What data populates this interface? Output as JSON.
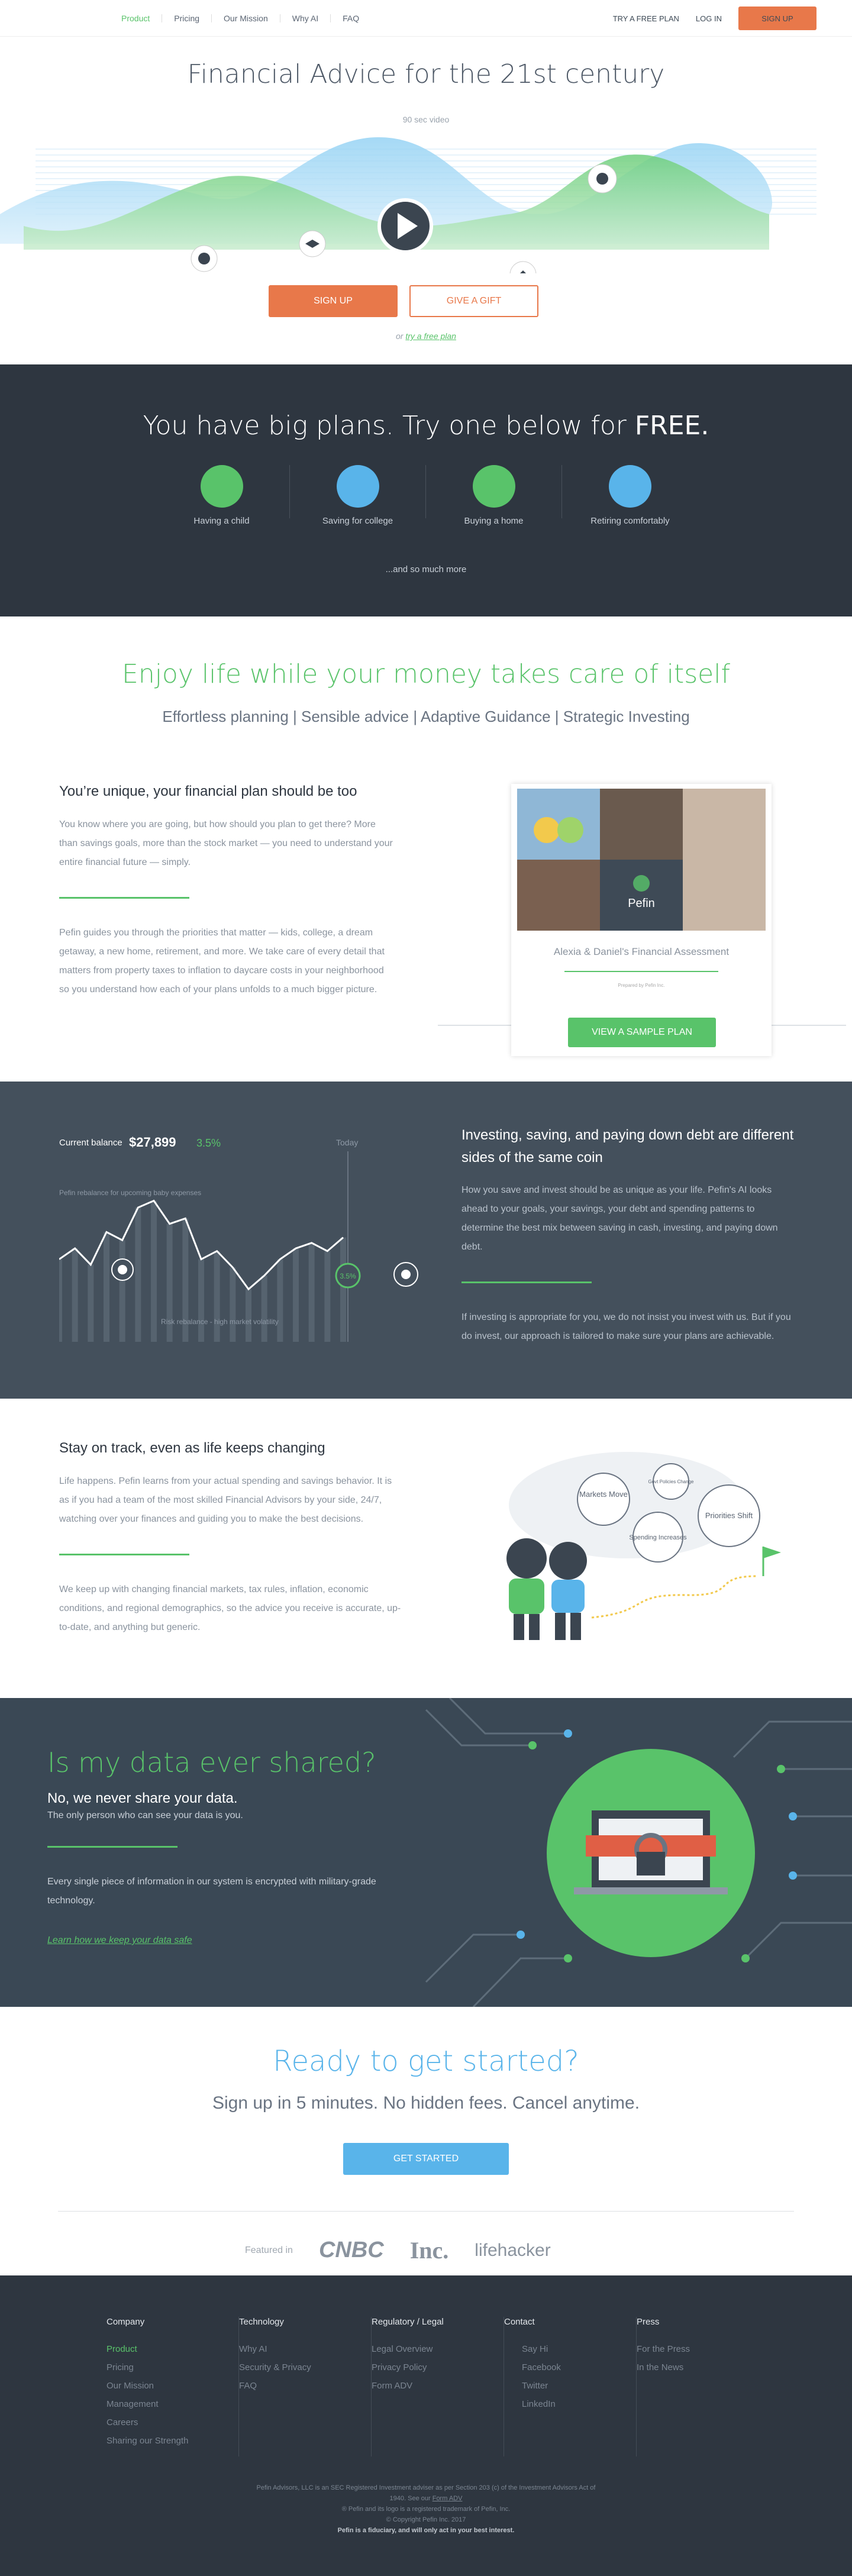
{
  "nav": {
    "links": [
      "Product",
      "Pricing",
      "Our Mission",
      "Why AI",
      "FAQ"
    ],
    "try_free": "TRY A FREE PLAN",
    "login": "LOG IN",
    "signup": "SIGN UP"
  },
  "hero": {
    "title": "Financial Advice for the 21st century",
    "video_label": "90 sec video",
    "signup": "SIGN UP",
    "gift": "GIVE A GIFT",
    "or": "or",
    "try_link": "try a free plan"
  },
  "plans": {
    "heading": "You have big plans. Try one below for",
    "heading_bold": "FREE.",
    "items": [
      {
        "label": "Having a child",
        "color": "#59c36a"
      },
      {
        "label": "Saving for college",
        "color": "#59b4ea"
      },
      {
        "label": "Buying a home",
        "color": "#59c36a"
      },
      {
        "label": "Retiring comfortably",
        "color": "#59b4ea"
      }
    ],
    "more": "...and so much more"
  },
  "enjoy": {
    "title": "Enjoy life while your money takes care of itself",
    "subtitle": "Effortless planning | Sensible advice | Adaptive Guidance | Strategic Investing",
    "heading": "You’re unique, your financial plan should be too",
    "p1": "You know where you are going, but how should you plan to get there? More than savings goals, more than the stock market — you need to understand your entire financial future — simply.",
    "p2": "Pefin guides you through the priorities that matter — kids, college, a dream getaway, a new home, retirement, and more. We take care of every detail that matters from property taxes to inflation to daycare costs in your neighborhood so you understand how each of your plans unfolds to a much bigger picture.",
    "card_brand": "Pefin",
    "card_name": "Alexia & Daniel's  Financial Assessment",
    "card_small": "Prepared by Pefin Inc.",
    "sample_btn": "VIEW A SAMPLE PLAN"
  },
  "invest": {
    "balance_label": "Current balance",
    "balance": "$27,899",
    "change": "3.5%",
    "today": "Today",
    "ann1": "Pefin rebalance for upcoming baby expenses",
    "ann2": "Risk rebalance - high market volatility",
    "marker": "3.5%",
    "heading": "Investing, saving, and paying down debt are different sides of the same coin",
    "p1": "How you save and invest should be as unique as your life. Pefin's AI looks ahead to your goals, your savings, your debt and spending patterns to determine the best mix between saving in cash, investing, and paying down debt.",
    "p2": "If investing is appropriate for you, we do not insist you invest with us. But if you do invest, our approach is tailored to make sure your plans are achievable.",
    "series": [
      0.52,
      0.6,
      0.48,
      0.72,
      0.66,
      0.9,
      0.95,
      0.78,
      0.82,
      0.52,
      0.58,
      0.46,
      0.3,
      0.4,
      0.52,
      0.6,
      0.64,
      0.58,
      0.68
    ]
  },
  "stay": {
    "heading": "Stay on track, even as life keeps changing",
    "p1": "Life happens. Pefin learns from your actual spending and savings behavior. It is as if you had a team of the most skilled Financial Advisors by your side, 24/7, watching over your finances and guiding you to make the best decisions.",
    "p2": "We keep up with changing financial markets, tax rules, inflation, economic conditions, and regional demographics, so the advice you receive is accurate, up-to-date, and anything but generic.",
    "bubbles": [
      "Markets Move",
      "Govt Policies Change",
      "Priorities Shift",
      "Spending Increases"
    ]
  },
  "data": {
    "title": "Is my data ever shared?",
    "subtitle": "No, we never share your data.",
    "p1": "The only person who can see your data is you.",
    "p2": "Every single piece of information in our system is encrypted with military-grade technology.",
    "link": "Learn how we keep your data safe"
  },
  "ready": {
    "title": "Ready to get started?",
    "subtitle": "Sign up in 5 minutes. No hidden fees. Cancel anytime.",
    "button": "GET STARTED",
    "featured": "Featured in",
    "logos": [
      "CNBC",
      "Inc.",
      "lifehacker"
    ]
  },
  "footer": {
    "columns": [
      {
        "head": "Company",
        "items": [
          "Product",
          "Pricing",
          "Our Mission",
          "Management",
          "Careers",
          "Sharing our Strength"
        ]
      },
      {
        "head": "Technology",
        "items": [
          "Why AI",
          "Security & Privacy",
          "FAQ"
        ]
      },
      {
        "head": "Regulatory / Legal",
        "items": [
          "Legal Overview",
          "Privacy Policy",
          "Form ADV"
        ]
      },
      {
        "head": "Contact",
        "items": [
          "Say Hi",
          "Facebook",
          "Twitter",
          "LinkedIn"
        ]
      },
      {
        "head": "Press",
        "items": [
          "For the Press",
          "In the News"
        ]
      }
    ],
    "legal1": "Pefin Advisors, LLC is an SEC Registered Investment adviser as per Section 203 (c) of the Investment Advisors Act of",
    "legal2a": "1940. See our",
    "legal2_link": "Form ADV",
    "legal3": "® Pefin and its logo is a registered trademark of Pefin, Inc.",
    "legal4": "© Copyright Pefin Inc. 2017",
    "legal5": "Pefin is a fiduciary, and will only act in your best interest."
  }
}
